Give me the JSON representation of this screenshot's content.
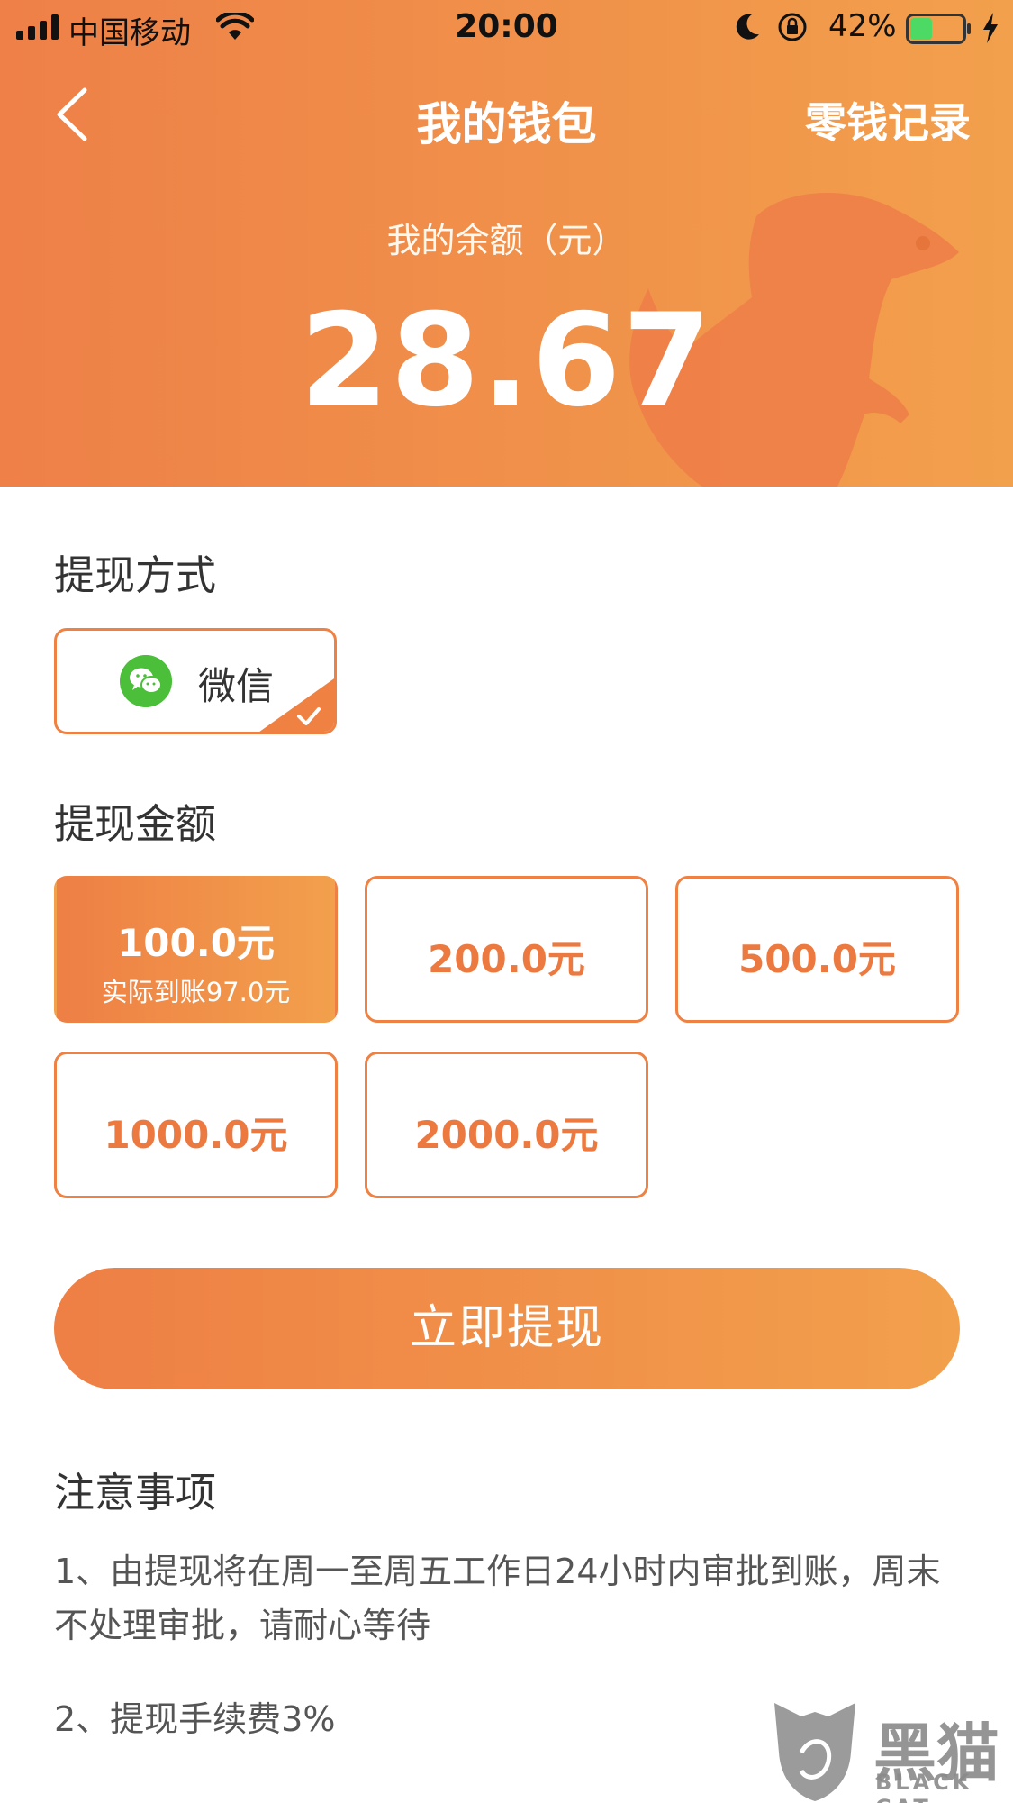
{
  "status_bar": {
    "carrier": "中国移动",
    "time": "20:00",
    "battery_percent": "42%",
    "battery_level": 0.42
  },
  "nav": {
    "title": "我的钱包",
    "right_link": "零钱记录",
    "back_icon": "chevron-left-icon"
  },
  "balance": {
    "label": "我的余额（元）",
    "value": "28.67"
  },
  "withdraw_method": {
    "title": "提现方式",
    "option_label": "微信",
    "option_icon": "wechat-icon",
    "selected": true
  },
  "withdraw_amount": {
    "title": "提现金额",
    "options": [
      {
        "label": "100.0元",
        "sub": "实际到账97.0元",
        "selected": true
      },
      {
        "label": "200.0元"
      },
      {
        "label": "500.0元"
      },
      {
        "label": "1000.0元"
      },
      {
        "label": "2000.0元"
      }
    ]
  },
  "submit_label": "立即提现",
  "notice": {
    "title": "注意事项",
    "items": [
      "1、由提现将在周一至周五工作日24小时内审批到账，周末不处理审批，请耐心等待",
      "2、提现手续费3%"
    ]
  },
  "watermark": {
    "text": "黑猫",
    "sub": "BLACK CAT"
  },
  "colors": {
    "accent": "#EF8143",
    "gradient_start": "#EE7F45",
    "gradient_end": "#F2A04C",
    "wechat_green": "#4CBF3A"
  }
}
